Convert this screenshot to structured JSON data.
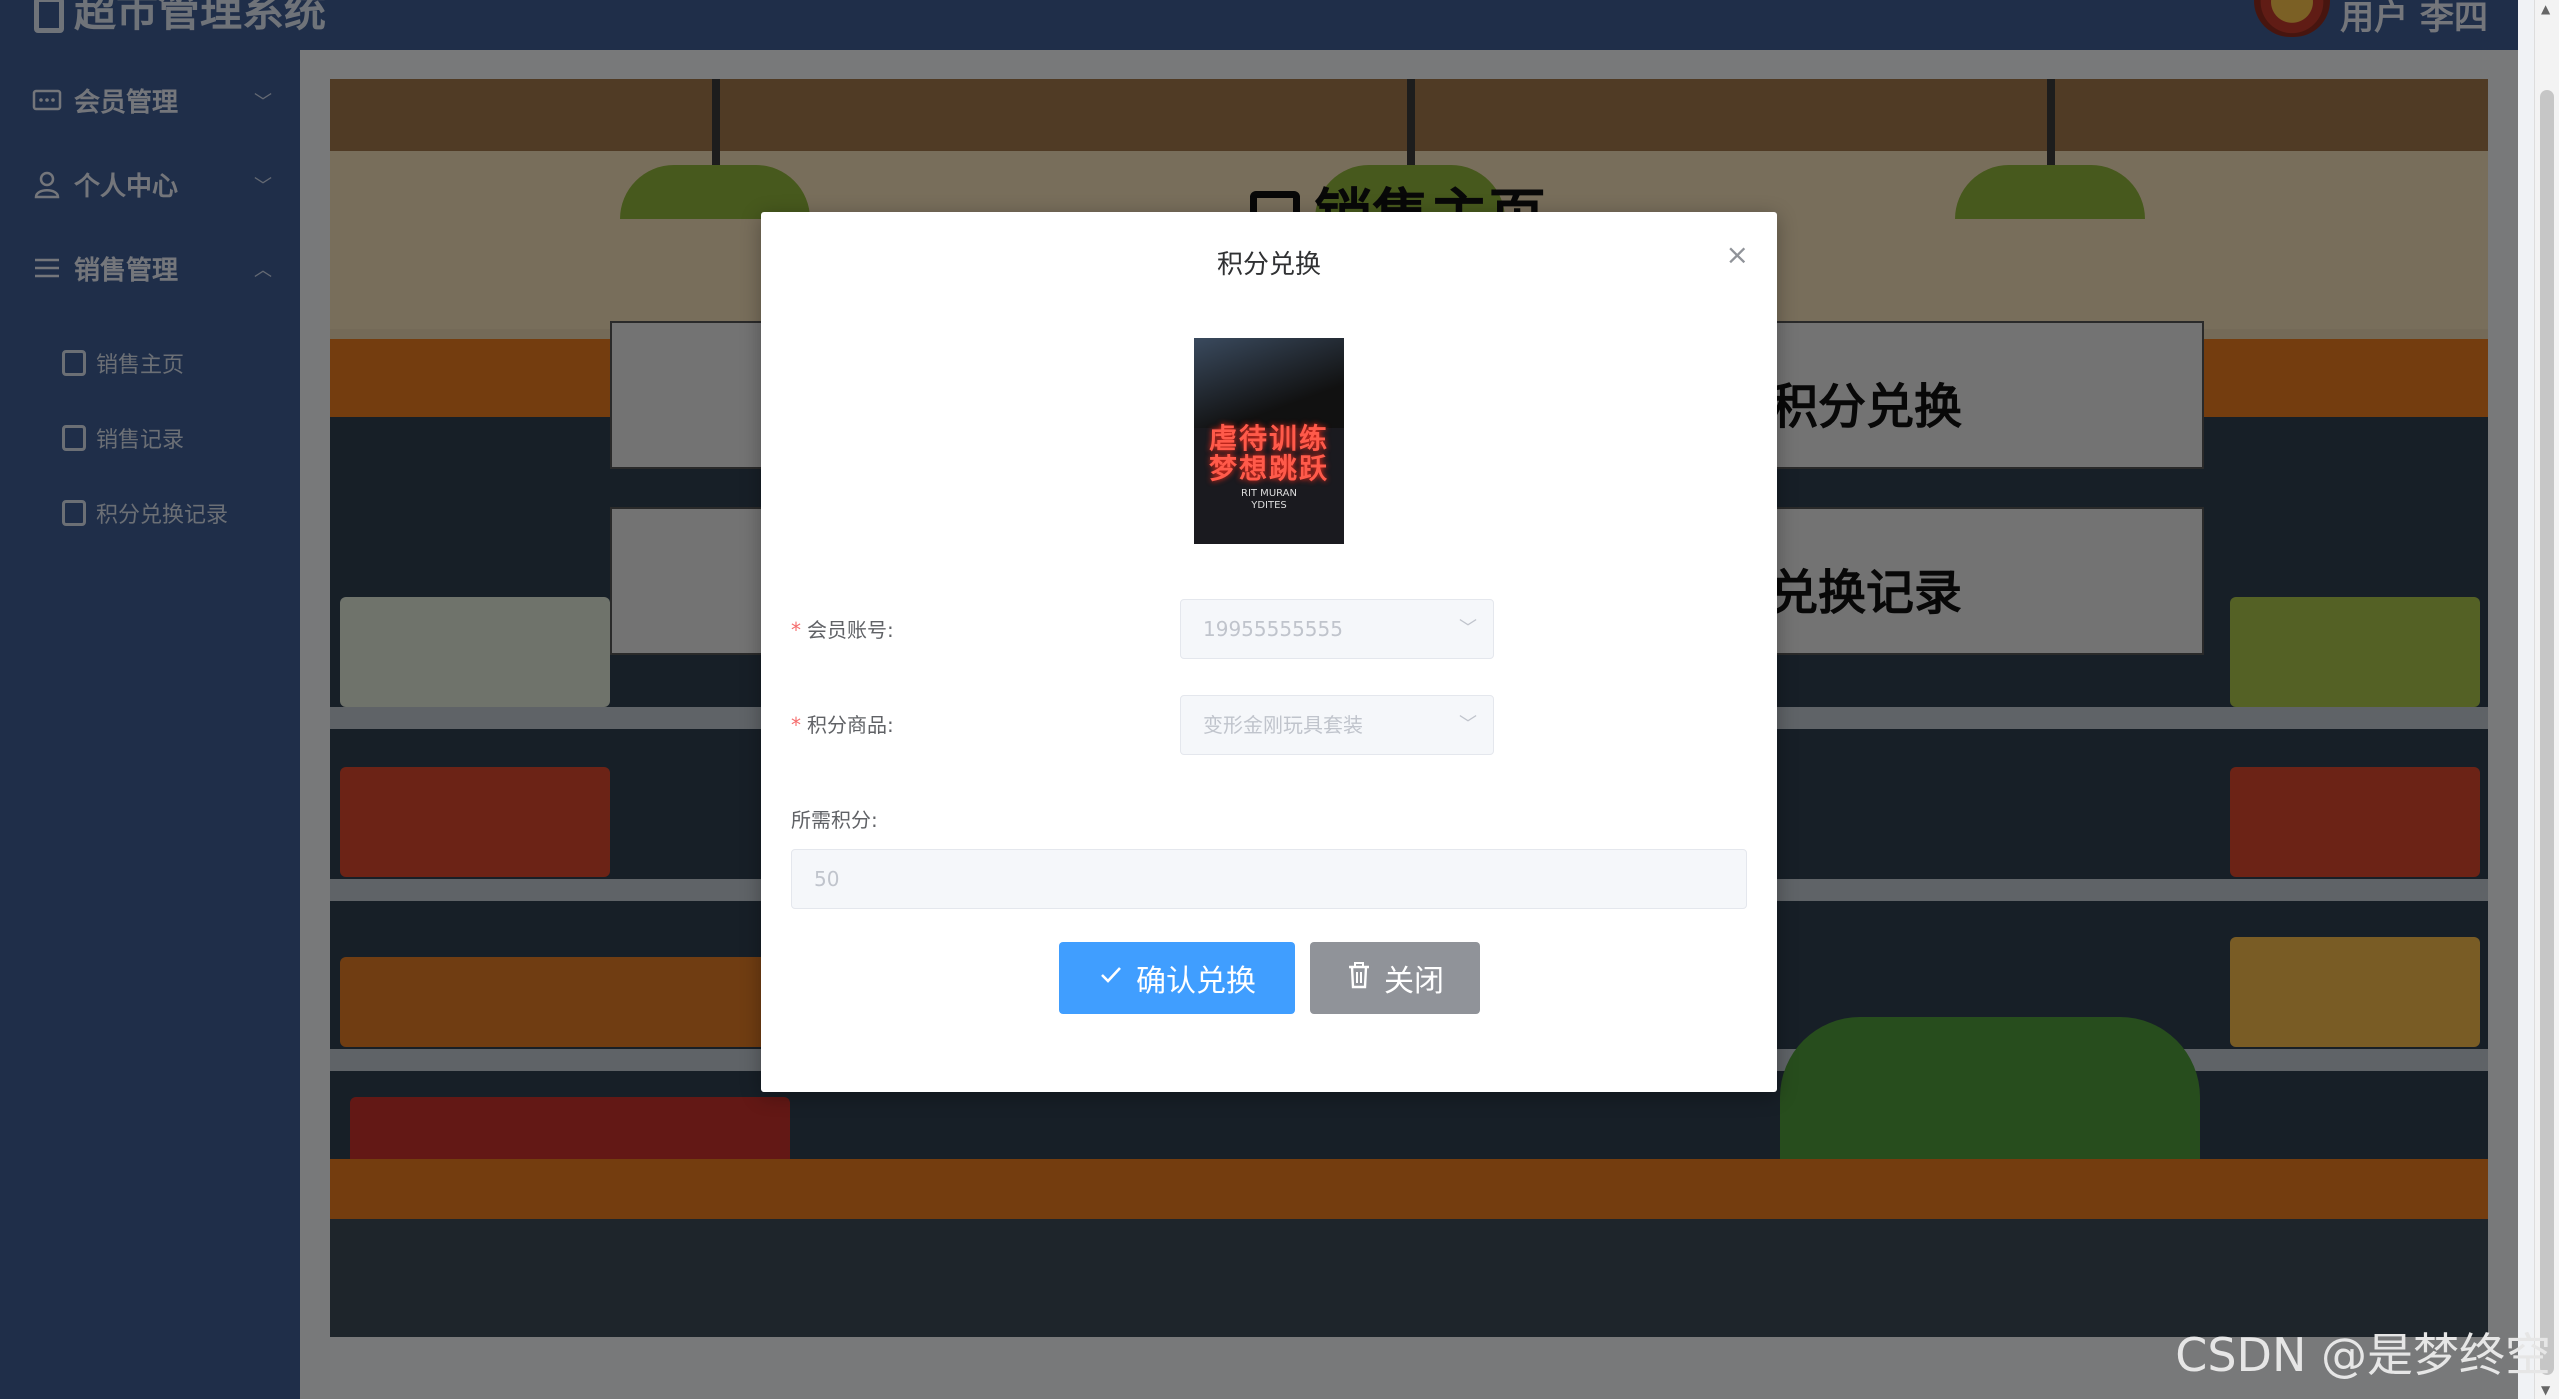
{
  "header": {
    "app_title": "超市管理系统",
    "user_label": "用户 李四"
  },
  "sidebar": {
    "menus": [
      {
        "label": "会员管理",
        "icon": "id-card-icon",
        "chevron": "﹀"
      },
      {
        "label": "个人中心",
        "icon": "user-icon",
        "chevron": "﹀"
      },
      {
        "label": "销售管理",
        "icon": "list-icon",
        "chevron": "︿"
      }
    ],
    "sub_items": [
      {
        "label": "销售主页"
      },
      {
        "label": "销售记录"
      },
      {
        "label": "积分兑换记录"
      }
    ]
  },
  "main": {
    "scene_title": "销售主页",
    "buttons": [
      {
        "label": "积分兑换"
      },
      {
        "label": "兑换记录"
      }
    ]
  },
  "modal": {
    "title": "积分兑换",
    "close_glyph": "×",
    "poster": {
      "neon_text": "虐待训练\n梦想跳跃",
      "small_text": "RIT MURAN\nYDITES"
    },
    "fields": {
      "member_label": "会员账号:",
      "member_value": "19955555555",
      "product_label": "积分商品:",
      "product_value": "变形金刚玩具套装",
      "required_star": "*",
      "points_label": "所需积分:",
      "points_value": "50"
    },
    "confirm_label": "确认兑换",
    "close_label": "关闭"
  },
  "watermark": "CSDN @是梦终空",
  "colors": {
    "sidebar_bg": "#3f5d93",
    "primary": "#409eff",
    "info": "#909399",
    "danger": "#f56c6c"
  }
}
